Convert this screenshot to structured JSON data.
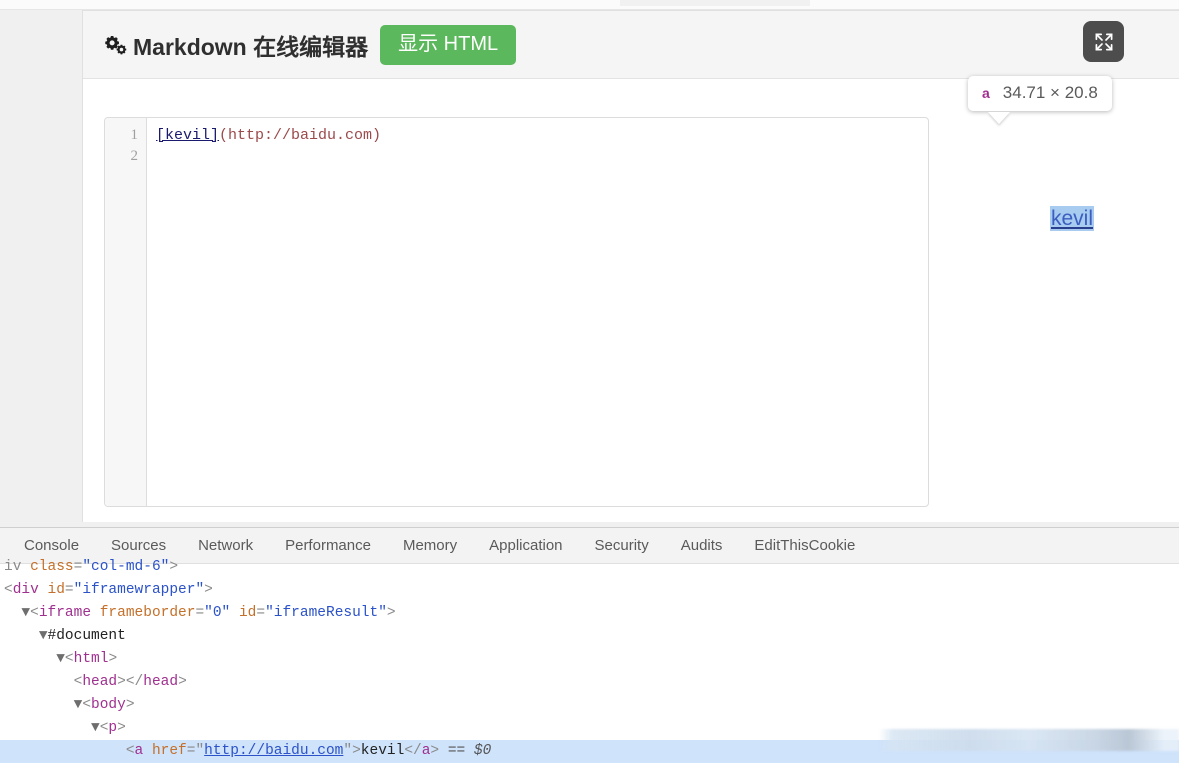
{
  "app": {
    "title": "Markdown 在线编辑器",
    "gear_icon": "cogs-icon",
    "show_html_button": "显示 HTML",
    "expand_button_icon": "expand-arrows-icon"
  },
  "editor": {
    "line_numbers": [
      "1",
      "2"
    ],
    "line1": {
      "link_text": "[kevil]",
      "url_text": "(http://baidu.com)"
    },
    "raw_source": "[kevil](http://baidu.com)"
  },
  "preview": {
    "link_label": "kevil",
    "link_href": "http://baidu.com"
  },
  "inspect_tooltip": {
    "tag": "a",
    "dimensions": "34.71 × 20.8",
    "tag_color": "#a0308f"
  },
  "devtools": {
    "tabs": [
      "Console",
      "Sources",
      "Network",
      "Performance",
      "Memory",
      "Application",
      "Security",
      "Audits",
      "EditThisCookie"
    ],
    "dom_lines": [
      {
        "indent": 0,
        "clipped": true,
        "selected": false,
        "tokens": [
          {
            "t": "punct",
            "v": "iv "
          },
          {
            "t": "attr",
            "v": "class"
          },
          {
            "t": "punct",
            "v": "="
          },
          {
            "t": "val",
            "v": "\"col-md-6\""
          },
          {
            "t": "punct",
            "v": ">"
          }
        ]
      },
      {
        "indent": 0,
        "selected": false,
        "tokens": [
          {
            "t": "punct",
            "v": "<"
          },
          {
            "t": "tag",
            "v": "div"
          },
          {
            "t": "punct",
            "v": " "
          },
          {
            "t": "attr",
            "v": "id"
          },
          {
            "t": "punct",
            "v": "="
          },
          {
            "t": "val",
            "v": "\"iframewrapper\""
          },
          {
            "t": "punct",
            "v": ">"
          }
        ]
      },
      {
        "indent": 1,
        "selected": false,
        "arrow": "▼",
        "tokens": [
          {
            "t": "punct",
            "v": "<"
          },
          {
            "t": "tag",
            "v": "iframe"
          },
          {
            "t": "punct",
            "v": " "
          },
          {
            "t": "attr",
            "v": "frameborder"
          },
          {
            "t": "punct",
            "v": "="
          },
          {
            "t": "val",
            "v": "\"0\""
          },
          {
            "t": "punct",
            "v": " "
          },
          {
            "t": "attr",
            "v": "id"
          },
          {
            "t": "punct",
            "v": "="
          },
          {
            "t": "val",
            "v": "\"iframeResult\""
          },
          {
            "t": "punct",
            "v": ">"
          }
        ]
      },
      {
        "indent": 2,
        "selected": false,
        "arrow": "▼",
        "tokens": [
          {
            "t": "doc",
            "v": "#document"
          }
        ]
      },
      {
        "indent": 3,
        "selected": false,
        "arrow": "▼",
        "tokens": [
          {
            "t": "punct",
            "v": "<"
          },
          {
            "t": "tag",
            "v": "html"
          },
          {
            "t": "punct",
            "v": ">"
          }
        ]
      },
      {
        "indent": 4,
        "selected": false,
        "tokens": [
          {
            "t": "punct",
            "v": "<"
          },
          {
            "t": "tag",
            "v": "head"
          },
          {
            "t": "punct",
            "v": "></"
          },
          {
            "t": "tag",
            "v": "head"
          },
          {
            "t": "punct",
            "v": ">"
          }
        ]
      },
      {
        "indent": 4,
        "selected": false,
        "arrow": "▼",
        "tokens": [
          {
            "t": "punct",
            "v": "<"
          },
          {
            "t": "tag",
            "v": "body"
          },
          {
            "t": "punct",
            "v": ">"
          }
        ]
      },
      {
        "indent": 5,
        "selected": false,
        "arrow": "▼",
        "tokens": [
          {
            "t": "punct",
            "v": "<"
          },
          {
            "t": "tag",
            "v": "p"
          },
          {
            "t": "punct",
            "v": ">"
          }
        ]
      },
      {
        "indent": 7,
        "selected": true,
        "tokens": [
          {
            "t": "punct",
            "v": "<"
          },
          {
            "t": "tag",
            "v": "a"
          },
          {
            "t": "punct",
            "v": " "
          },
          {
            "t": "attr",
            "v": "href"
          },
          {
            "t": "punct",
            "v": "=\""
          },
          {
            "t": "val-link",
            "v": "http://baidu.com"
          },
          {
            "t": "punct",
            "v": "\">"
          },
          {
            "t": "text",
            "v": "kevil"
          },
          {
            "t": "punct",
            "v": "</"
          },
          {
            "t": "tag",
            "v": "a"
          },
          {
            "t": "punct",
            "v": "> "
          },
          {
            "t": "ref",
            "v": "== $0"
          }
        ]
      }
    ]
  }
}
